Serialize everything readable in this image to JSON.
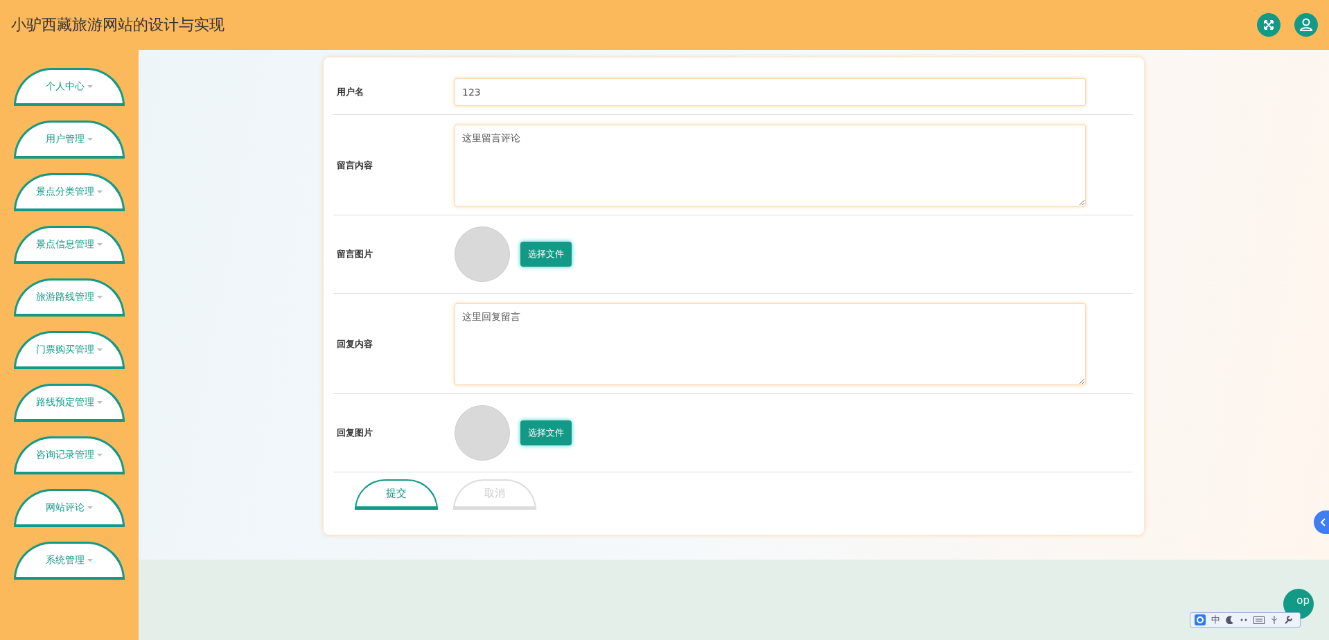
{
  "header": {
    "title": "小驴西藏旅游网站的设计与实现"
  },
  "sidebar": {
    "items": [
      {
        "label": "个人中心"
      },
      {
        "label": "用户管理"
      },
      {
        "label": "景点分类管理"
      },
      {
        "label": "景点信息管理"
      },
      {
        "label": "旅游路线管理"
      },
      {
        "label": "门票购买管理"
      },
      {
        "label": "路线预定管理"
      },
      {
        "label": "咨询记录管理"
      },
      {
        "label": "网站评论"
      },
      {
        "label": "系统管理"
      }
    ]
  },
  "form": {
    "fields": [
      {
        "kind": "text",
        "label": "用户名",
        "value": "123"
      },
      {
        "kind": "textarea",
        "label": "留言内容",
        "value": "这里留言评论"
      },
      {
        "kind": "image",
        "label": "留言图片",
        "button": "选择文件"
      },
      {
        "kind": "textarea",
        "label": "回复内容",
        "value": "这里回复留言"
      },
      {
        "kind": "image",
        "label": "回复图片",
        "button": "选择文件"
      }
    ],
    "actions": [
      {
        "kind": "primary",
        "label": "提交"
      },
      {
        "kind": "cancel",
        "label": "取消"
      }
    ]
  },
  "top_button": {
    "label": "op"
  },
  "ime_toolbar": {
    "mode": "中"
  }
}
